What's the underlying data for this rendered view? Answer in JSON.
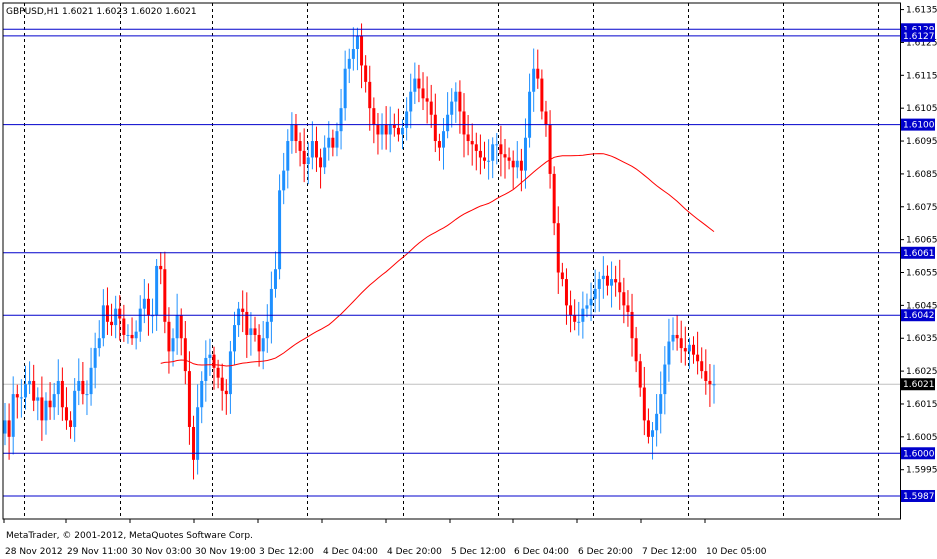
{
  "header": {
    "title": "GBPUSD,H1  1.6021 1.6023 1.6020 1.6021"
  },
  "footer": {
    "copyright": "MetaTrader, © 2001-2012, MetaQuotes Software Corp."
  },
  "colors": {
    "background": "#ffffff",
    "bull": "#1e90ff",
    "bear": "#ff0000",
    "ma": "#ff0000",
    "level": "#0000cc",
    "grid": "#000000",
    "current": "#c0c0c0",
    "tag_bg": "#0000cc",
    "tag_text": "#ffffff",
    "current_tag_bg": "#000000"
  },
  "chart_data": {
    "type": "candlestick",
    "symbol": "GBPUSD",
    "timeframe": "H1",
    "ylim": [
      1.598,
      1.6137
    ],
    "y_ticks": [
      "1.6135",
      "1.6125",
      "1.6115",
      "1.6105",
      "1.6095",
      "1.6085",
      "1.6075",
      "1.6065",
      "1.6055",
      "1.6045",
      "1.6035",
      "1.6025",
      "1.6015",
      "1.6005",
      "1.5995"
    ],
    "x_labels": [
      "28 Nov 2012",
      "29 Nov 11:00",
      "30 Nov 03:00",
      "30 Nov 19:00",
      "3 Dec 12:00",
      "4 Dec 04:00",
      "4 Dec 20:00",
      "5 Dec 12:00",
      "6 Dec 04:00",
      "6 Dec 20:00",
      "7 Dec 12:00",
      "10 Dec 05:00"
    ],
    "horizontal_levels": [
      {
        "value": 1.6129,
        "label": "1.6129"
      },
      {
        "value": 1.6127,
        "label": "1.6127"
      },
      {
        "value": 1.61,
        "label": "1.6100"
      },
      {
        "value": 1.6061,
        "label": "1.6061"
      },
      {
        "value": 1.6042,
        "label": "1.6042"
      },
      {
        "value": 1.6,
        "label": "1.6000"
      },
      {
        "value": 1.5987,
        "label": "1.5987"
      }
    ],
    "current_price": {
      "value": 1.6021,
      "label": "1.6021"
    },
    "anchors": [
      [
        1.601,
        1.6005
      ],
      [
        1.6018,
        1.6017
      ],
      [
        1.6017,
        1.6021
      ],
      [
        1.6022,
        1.6016
      ],
      [
        1.6017,
        1.601
      ],
      [
        1.6016,
        1.6014
      ],
      [
        1.6018,
        1.6022
      ],
      [
        1.6014,
        1.601
      ],
      [
        1.6008,
        1.6019
      ],
      [
        1.6022,
        1.6018
      ],
      [
        1.6018,
        1.6026
      ],
      [
        1.6032,
        1.6035
      ],
      [
        1.6045,
        1.604
      ],
      [
        1.6039,
        1.6044
      ],
      [
        1.6041,
        1.6036
      ],
      [
        1.6036,
        1.6035
      ],
      [
        1.6037,
        1.6044
      ],
      [
        1.6047,
        1.6042
      ],
      [
        1.6042,
        1.6057
      ],
      [
        1.6056,
        1.604
      ],
      [
        1.6031,
        1.6035
      ],
      [
        1.6042,
        1.6035
      ],
      [
        1.6025,
        1.6008
      ],
      [
        1.5998,
        1.6014
      ],
      [
        1.6022,
        1.6029
      ],
      [
        1.603,
        1.6026
      ],
      [
        1.6023,
        1.6019
      ],
      [
        1.6018,
        1.6031
      ],
      [
        1.6039,
        1.6044
      ],
      [
        1.6043,
        1.6036
      ],
      [
        1.6038,
        1.6036
      ],
      [
        1.6031,
        1.6035
      ],
      [
        1.604,
        1.605
      ],
      [
        1.6056,
        1.608
      ],
      [
        1.6086,
        1.6095
      ],
      [
        1.61,
        1.6095
      ],
      [
        1.6092,
        1.6088
      ],
      [
        1.609,
        1.6095
      ],
      [
        1.609,
        1.6087
      ],
      [
        1.6093,
        1.6096
      ],
      [
        1.6093,
        1.6098
      ],
      [
        1.6105,
        1.6117
      ],
      [
        1.612,
        1.6123
      ],
      [
        1.6127,
        1.6118
      ],
      [
        1.6113,
        1.6105
      ],
      [
        1.61,
        1.6097
      ],
      [
        1.61,
        1.6097
      ],
      [
        1.61,
        1.6099
      ],
      [
        1.6097,
        1.6099
      ],
      [
        1.6104,
        1.611
      ],
      [
        1.6114,
        1.6111
      ],
      [
        1.6108,
        1.6107
      ],
      [
        1.6103,
        1.6095
      ],
      [
        1.6093,
        1.6098
      ],
      [
        1.6103,
        1.6107
      ],
      [
        1.611,
        1.6104
      ],
      [
        1.6097,
        1.6095
      ],
      [
        1.6094,
        1.6092
      ],
      [
        1.609,
        1.6089
      ],
      [
        1.6089,
        1.6094
      ],
      [
        1.6094,
        1.6091
      ],
      [
        1.609,
        1.6089
      ],
      [
        1.6087,
        1.6089
      ],
      [
        1.6086,
        1.6096
      ],
      [
        1.611,
        1.6117
      ],
      [
        1.6114,
        1.6104
      ],
      [
        1.61,
        1.6085
      ],
      [
        1.607,
        1.6055
      ],
      [
        1.6053,
        1.6045
      ],
      [
        1.6042,
        1.604
      ],
      [
        1.604,
        1.6044
      ],
      [
        1.6045,
        1.6047
      ],
      [
        1.605,
        1.6053
      ],
      [
        1.6054,
        1.6051
      ],
      [
        1.6053,
        1.6052
      ],
      [
        1.6049,
        1.6045
      ],
      [
        1.6043,
        1.6035
      ],
      [
        1.6028,
        1.602
      ],
      [
        1.601,
        1.6005
      ],
      [
        1.6007,
        1.6012
      ],
      [
        1.6018,
        1.6027
      ],
      [
        1.6034,
        1.6036
      ],
      [
        1.6035,
        1.6032
      ],
      [
        1.6031,
        1.6033
      ],
      [
        1.603,
        1.6028
      ],
      [
        1.6025,
        1.6022
      ],
      [
        1.6021,
        1.6021
      ]
    ]
  }
}
